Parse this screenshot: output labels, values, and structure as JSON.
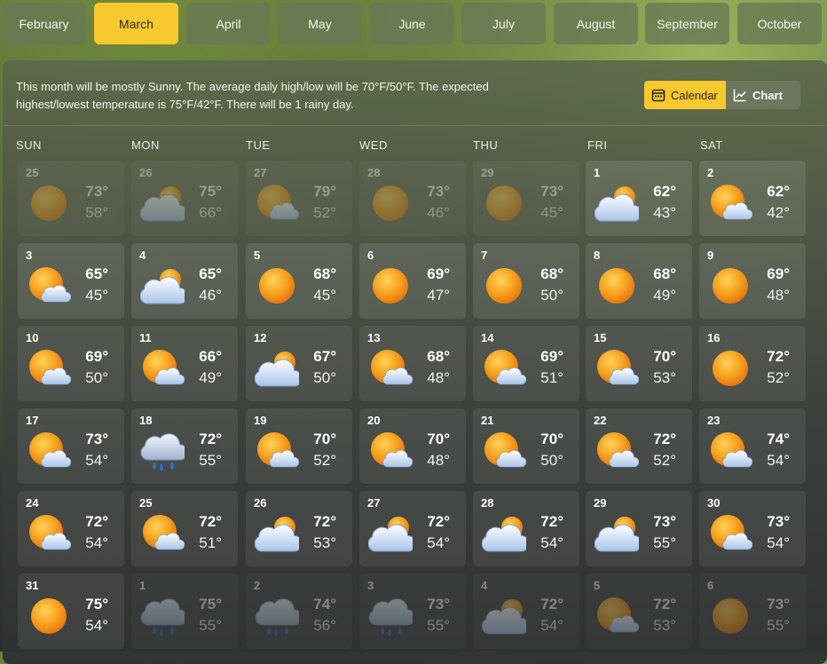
{
  "months": [
    {
      "label": "February",
      "active": false
    },
    {
      "label": "March",
      "active": true
    },
    {
      "label": "April",
      "active": false
    },
    {
      "label": "May",
      "active": false
    },
    {
      "label": "June",
      "active": false
    },
    {
      "label": "July",
      "active": false
    },
    {
      "label": "August",
      "active": false
    },
    {
      "label": "September",
      "active": false
    },
    {
      "label": "October",
      "active": false
    }
  ],
  "summary": "This month will be mostly Sunny. The average daily high/low will be 70°F/50°F. The expected highest/lowest temperature is 75°F/42°F. There will be 1 rainy day.",
  "view_toggle": {
    "calendar_label": "Calendar",
    "chart_label": "Chart"
  },
  "weekdays": [
    "SUN",
    "MON",
    "TUE",
    "WED",
    "THU",
    "FRI",
    "SAT"
  ],
  "icons": {
    "sunny": "sun-icon",
    "mostly-sunny": "sun-small-cloud-icon",
    "partly-cloudy": "sun-behind-cloud-icon",
    "rain": "rain-cloud-icon"
  },
  "colors": {
    "accent": "#f7c92f",
    "sun": "#f39a1c",
    "cloud": "#dfe9f7"
  },
  "weeks": [
    [
      {
        "day": "25",
        "hi": "73°",
        "lo": "58°",
        "icon": "sunny",
        "other": true
      },
      {
        "day": "26",
        "hi": "75°",
        "lo": "66°",
        "icon": "partly-cloudy",
        "other": true
      },
      {
        "day": "27",
        "hi": "79°",
        "lo": "52°",
        "icon": "mostly-sunny",
        "other": true
      },
      {
        "day": "28",
        "hi": "73°",
        "lo": "46°",
        "icon": "sunny",
        "other": true
      },
      {
        "day": "29",
        "hi": "73°",
        "lo": "45°",
        "icon": "sunny",
        "other": true
      },
      {
        "day": "1",
        "hi": "62°",
        "lo": "43°",
        "icon": "partly-cloudy",
        "other": false
      },
      {
        "day": "2",
        "hi": "62°",
        "lo": "42°",
        "icon": "mostly-sunny",
        "other": false
      }
    ],
    [
      {
        "day": "3",
        "hi": "65°",
        "lo": "45°",
        "icon": "mostly-sunny",
        "other": false
      },
      {
        "day": "4",
        "hi": "65°",
        "lo": "46°",
        "icon": "partly-cloudy",
        "other": false
      },
      {
        "day": "5",
        "hi": "68°",
        "lo": "45°",
        "icon": "sunny",
        "other": false
      },
      {
        "day": "6",
        "hi": "69°",
        "lo": "47°",
        "icon": "sunny",
        "other": false
      },
      {
        "day": "7",
        "hi": "68°",
        "lo": "50°",
        "icon": "sunny",
        "other": false
      },
      {
        "day": "8",
        "hi": "68°",
        "lo": "49°",
        "icon": "sunny",
        "other": false
      },
      {
        "day": "9",
        "hi": "69°",
        "lo": "48°",
        "icon": "sunny",
        "other": false
      }
    ],
    [
      {
        "day": "10",
        "hi": "69°",
        "lo": "50°",
        "icon": "mostly-sunny",
        "other": false
      },
      {
        "day": "11",
        "hi": "66°",
        "lo": "49°",
        "icon": "mostly-sunny",
        "other": false
      },
      {
        "day": "12",
        "hi": "67°",
        "lo": "50°",
        "icon": "partly-cloudy",
        "other": false
      },
      {
        "day": "13",
        "hi": "68°",
        "lo": "48°",
        "icon": "mostly-sunny",
        "other": false
      },
      {
        "day": "14",
        "hi": "69°",
        "lo": "51°",
        "icon": "mostly-sunny",
        "other": false
      },
      {
        "day": "15",
        "hi": "70°",
        "lo": "53°",
        "icon": "mostly-sunny",
        "other": false
      },
      {
        "day": "16",
        "hi": "72°",
        "lo": "52°",
        "icon": "sunny",
        "other": false
      }
    ],
    [
      {
        "day": "17",
        "hi": "73°",
        "lo": "54°",
        "icon": "mostly-sunny",
        "other": false
      },
      {
        "day": "18",
        "hi": "72°",
        "lo": "55°",
        "icon": "rain",
        "other": false
      },
      {
        "day": "19",
        "hi": "70°",
        "lo": "52°",
        "icon": "mostly-sunny",
        "other": false
      },
      {
        "day": "20",
        "hi": "70°",
        "lo": "48°",
        "icon": "mostly-sunny",
        "other": false
      },
      {
        "day": "21",
        "hi": "70°",
        "lo": "50°",
        "icon": "mostly-sunny",
        "other": false
      },
      {
        "day": "22",
        "hi": "72°",
        "lo": "52°",
        "icon": "mostly-sunny",
        "other": false
      },
      {
        "day": "23",
        "hi": "74°",
        "lo": "54°",
        "icon": "mostly-sunny",
        "other": false
      }
    ],
    [
      {
        "day": "24",
        "hi": "72°",
        "lo": "54°",
        "icon": "mostly-sunny",
        "other": false
      },
      {
        "day": "25",
        "hi": "72°",
        "lo": "51°",
        "icon": "mostly-sunny",
        "other": false
      },
      {
        "day": "26",
        "hi": "72°",
        "lo": "53°",
        "icon": "partly-cloudy",
        "other": false
      },
      {
        "day": "27",
        "hi": "72°",
        "lo": "54°",
        "icon": "partly-cloudy",
        "other": false
      },
      {
        "day": "28",
        "hi": "72°",
        "lo": "54°",
        "icon": "partly-cloudy",
        "other": false
      },
      {
        "day": "29",
        "hi": "73°",
        "lo": "55°",
        "icon": "partly-cloudy",
        "other": false
      },
      {
        "day": "30",
        "hi": "73°",
        "lo": "54°",
        "icon": "mostly-sunny",
        "other": false
      }
    ],
    [
      {
        "day": "31",
        "hi": "75°",
        "lo": "54°",
        "icon": "sunny",
        "other": false
      },
      {
        "day": "1",
        "hi": "75°",
        "lo": "55°",
        "icon": "rain",
        "other": true
      },
      {
        "day": "2",
        "hi": "74°",
        "lo": "56°",
        "icon": "rain",
        "other": true
      },
      {
        "day": "3",
        "hi": "73°",
        "lo": "55°",
        "icon": "rain",
        "other": true
      },
      {
        "day": "4",
        "hi": "72°",
        "lo": "54°",
        "icon": "partly-cloudy",
        "other": true
      },
      {
        "day": "5",
        "hi": "72°",
        "lo": "53°",
        "icon": "mostly-sunny",
        "other": true
      },
      {
        "day": "6",
        "hi": "73°",
        "lo": "55°",
        "icon": "sunny",
        "other": true
      }
    ]
  ]
}
